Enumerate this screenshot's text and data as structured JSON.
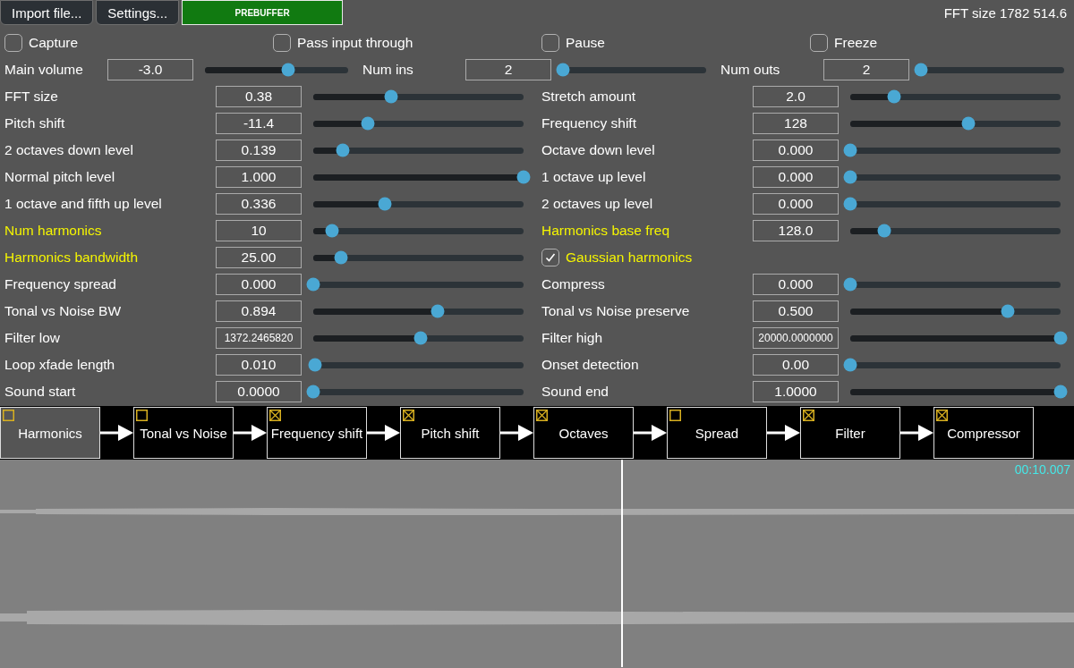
{
  "toolbar": {
    "buttons": [
      {
        "label": "Import file...",
        "kind": "normal"
      },
      {
        "label": "Settings...",
        "kind": "normal"
      },
      {
        "label": "PREBUFFER",
        "kind": "status"
      }
    ],
    "info": "FFT size 1782 514.6"
  },
  "toggles": [
    {
      "label": "Capture",
      "checked": false
    },
    {
      "label": "Pass input through",
      "checked": false
    },
    {
      "label": "Pause",
      "checked": false
    },
    {
      "label": "Freeze",
      "checked": false
    }
  ],
  "io_controls": [
    {
      "label": "Main volume",
      "value": "-3.0",
      "level": 0.58
    },
    {
      "label": "Num ins",
      "value": "2",
      "level": 0
    },
    {
      "label": "Num outs",
      "value": "2",
      "level": 0
    }
  ],
  "param_rows": [
    {
      "left": {
        "kind": "slider",
        "label": "FFT size",
        "value": "0.38",
        "level": 0.37,
        "highlight": false
      },
      "right": {
        "kind": "slider",
        "label": "Stretch amount",
        "value": "2.0",
        "level": 0.21,
        "highlight": false
      }
    },
    {
      "left": {
        "kind": "slider",
        "label": "Pitch shift",
        "value": "-11.4",
        "level": 0.26,
        "highlight": false
      },
      "right": {
        "kind": "slider",
        "label": "Frequency shift",
        "value": "128",
        "level": 0.56,
        "highlight": false
      }
    },
    {
      "left": {
        "kind": "slider",
        "label": "2 octaves down level",
        "value": "0.139",
        "level": 0.14,
        "highlight": false
      },
      "right": {
        "kind": "slider",
        "label": "Octave down level",
        "value": "0.000",
        "level": 0,
        "highlight": false
      }
    },
    {
      "left": {
        "kind": "slider",
        "label": "Normal pitch level",
        "value": "1.000",
        "level": 1,
        "highlight": false
      },
      "right": {
        "kind": "slider",
        "label": "1 octave up level",
        "value": "0.000",
        "level": 0,
        "highlight": false
      }
    },
    {
      "left": {
        "kind": "slider",
        "label": "1 octave and fifth up level",
        "value": "0.336",
        "level": 0.34,
        "highlight": false
      },
      "right": {
        "kind": "slider",
        "label": "2 octaves up level",
        "value": "0.000",
        "level": 0,
        "highlight": false
      }
    },
    {
      "left": {
        "kind": "slider",
        "label": "Num harmonics",
        "value": "10",
        "level": 0.09,
        "highlight": true
      },
      "right": {
        "kind": "slider",
        "label": "Harmonics base freq",
        "value": "128.0",
        "level": 0.16,
        "highlight": true
      }
    },
    {
      "left": {
        "kind": "slider",
        "label": "Harmonics bandwidth",
        "value": "25.00",
        "level": 0.13,
        "highlight": true
      },
      "right": {
        "kind": "checkbox",
        "label": "Gaussian harmonics",
        "checked": true,
        "highlight": true
      }
    },
    {
      "left": {
        "kind": "slider",
        "label": "Frequency spread",
        "value": "0.000",
        "level": 0,
        "highlight": false
      },
      "right": {
        "kind": "slider",
        "label": "Compress",
        "value": "0.000",
        "level": 0,
        "highlight": false
      }
    },
    {
      "left": {
        "kind": "slider",
        "label": "Tonal vs Noise BW",
        "value": "0.894",
        "level": 0.59,
        "highlight": false
      },
      "right": {
        "kind": "slider",
        "label": "Tonal vs Noise preserve",
        "value": "0.500",
        "level": 0.75,
        "highlight": false
      }
    },
    {
      "left": {
        "kind": "slider",
        "label": "Filter low",
        "value": "1372.2465820",
        "level": 0.51,
        "highlight": false
      },
      "right": {
        "kind": "slider",
        "label": "Filter high",
        "value": "20000.0000000",
        "level": 1,
        "highlight": false
      }
    },
    {
      "left": {
        "kind": "slider",
        "label": "Loop xfade length",
        "value": "0.010",
        "level": 0.01,
        "highlight": false
      },
      "right": {
        "kind": "slider",
        "label": "Onset detection",
        "value": "0.00",
        "level": 0,
        "highlight": false
      }
    },
    {
      "left": {
        "kind": "slider",
        "label": "Sound start",
        "value": "0.0000",
        "level": 0,
        "highlight": false
      },
      "right": {
        "kind": "slider",
        "label": "Sound end",
        "value": "1.0000",
        "level": 1,
        "highlight": false
      }
    }
  ],
  "chain": [
    {
      "label": "Harmonics",
      "enabled": false,
      "selected": true
    },
    {
      "label": "Tonal vs Noise",
      "enabled": false,
      "selected": false
    },
    {
      "label": "Frequency shift",
      "enabled": true,
      "selected": false
    },
    {
      "label": "Pitch shift",
      "enabled": true,
      "selected": false
    },
    {
      "label": "Octaves",
      "enabled": true,
      "selected": false
    },
    {
      "label": "Spread",
      "enabled": false,
      "selected": false
    },
    {
      "label": "Filter",
      "enabled": true,
      "selected": false
    },
    {
      "label": "Compressor",
      "enabled": true,
      "selected": false
    }
  ],
  "waveform": {
    "time": "00:10.007",
    "playhead": {
      "level": 0.578
    }
  }
}
